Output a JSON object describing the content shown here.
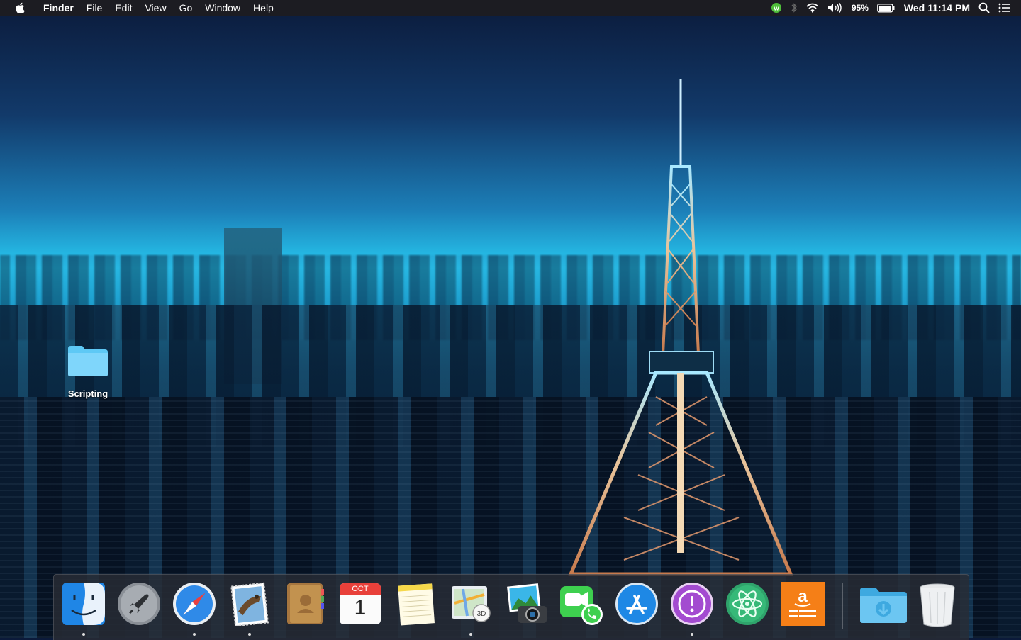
{
  "menubar": {
    "apple_icon": "apple-logo-icon",
    "app_name": "Finder",
    "menus": [
      "File",
      "Edit",
      "View",
      "Go",
      "Window",
      "Help"
    ],
    "status_icons": [
      "wunderlist-icon",
      "bluetooth-icon",
      "wifi-icon",
      "volume-icon"
    ],
    "battery_percent": "95%",
    "clock": "Wed 11:14 PM",
    "right_icons": [
      "spotlight-search-icon",
      "notification-center-icon"
    ]
  },
  "desktop": {
    "folders": [
      {
        "label": "Scripting"
      }
    ]
  },
  "dock": {
    "apps": [
      {
        "name": "Finder",
        "icon": "finder-icon",
        "running": true
      },
      {
        "name": "Launchpad",
        "icon": "launchpad-rocket-icon",
        "running": false
      },
      {
        "name": "Safari",
        "icon": "safari-compass-icon",
        "running": true
      },
      {
        "name": "Mail",
        "icon": "mail-stamp-icon",
        "running": true
      },
      {
        "name": "Contacts",
        "icon": "contacts-book-icon",
        "running": false
      },
      {
        "name": "Calendar",
        "icon": "calendar-icon",
        "running": false,
        "month": "OCT",
        "day": "1"
      },
      {
        "name": "Notes",
        "icon": "notes-icon",
        "running": false
      },
      {
        "name": "Maps",
        "icon": "maps-icon",
        "running": true,
        "badge": "3D"
      },
      {
        "name": "Image Capture",
        "icon": "image-capture-camera-icon",
        "running": false
      },
      {
        "name": "FaceTime",
        "icon": "facetime-icon",
        "running": false
      },
      {
        "name": "App Store",
        "icon": "app-store-icon",
        "running": false
      },
      {
        "name": "Feedback Assistant",
        "icon": "feedback-exclamation-icon",
        "running": true
      },
      {
        "name": "Atom",
        "icon": "atom-editor-icon",
        "running": false
      },
      {
        "name": "Amazon",
        "icon": "amazon-icon",
        "running": false
      },
      {
        "name": "Downloads",
        "icon": "downloads-folder-icon",
        "running": false
      },
      {
        "name": "Trash",
        "icon": "trash-icon",
        "running": false
      }
    ]
  }
}
